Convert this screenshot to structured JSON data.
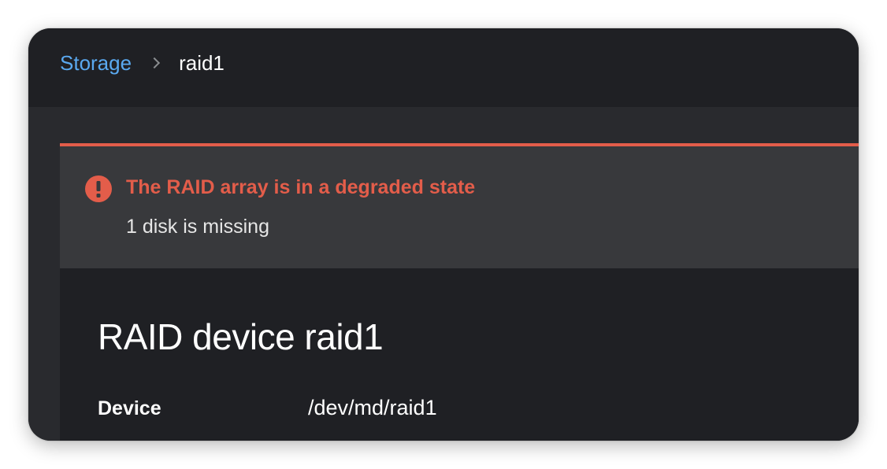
{
  "breadcrumb": {
    "parent_label": "Storage",
    "current_label": "raid1"
  },
  "alert": {
    "severity": "danger",
    "icon": "exclamation-circle-icon",
    "title": "The RAID array is in a degraded state",
    "description": "1 disk is missing"
  },
  "device": {
    "title": "RAID device raid1",
    "details": [
      {
        "label": "Device",
        "value": "/dev/md/raid1"
      }
    ]
  },
  "colors": {
    "link": "#5aa9f0",
    "danger": "#e35d4a",
    "header_bg": "#1f2024",
    "page_bg": "#292a2e",
    "alert_bg": "#38393c"
  }
}
